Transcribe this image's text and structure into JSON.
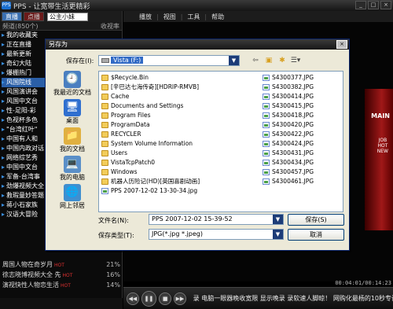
{
  "app": {
    "title": "PPS - 让宽带生活更精彩",
    "logo": "PPS",
    "window_controls": [
      "_",
      "□",
      "×"
    ]
  },
  "left_panel": {
    "tabs": [
      "直播",
      "点播"
    ],
    "search_value": "公主小妹",
    "channel_header": {
      "label": "频道(850个)",
      "right": "收视率"
    },
    "categories": [
      {
        "label": "我的收藏夹",
        "active": false
      },
      {
        "label": "正在直播",
        "active": false
      },
      {
        "label": "最新更新",
        "active": false
      },
      {
        "label": "奇幻大陆",
        "active": false
      },
      {
        "label": "爆棚热门",
        "active": false
      },
      {
        "label": "风国院线",
        "active": true
      },
      {
        "label": "风国演讲会",
        "active": false
      },
      {
        "label": "风国中文台",
        "active": false
      },
      {
        "label": "性-足阳-彩",
        "active": false
      },
      {
        "label": "色视杯多色",
        "active": false
      },
      {
        "label": "\"台湾红叶\"",
        "active": false
      },
      {
        "label": "中国有人和",
        "active": false
      },
      {
        "label": "中国内政对话",
        "active": false
      },
      {
        "label": "网络综艺秀",
        "active": false
      },
      {
        "label": "中国中文台",
        "active": false
      },
      {
        "label": "军备-台湾事",
        "active": false
      },
      {
        "label": "劲爆视频大全",
        "active": false
      },
      {
        "label": "救瑕童妙答题",
        "active": false
      },
      {
        "label": "蒋小石家族",
        "active": false
      },
      {
        "label": "汉语大冒险",
        "active": false
      }
    ],
    "channels": [
      {
        "name": "周国人物在奇岁月",
        "hot": "HOT",
        "rate": "21%"
      },
      {
        "name": "徐志晓博视频大全 先",
        "hot": "HOT",
        "rate": "16%"
      },
      {
        "name": "演视快性人物恋生活",
        "hot": "HOT",
        "rate": "14%"
      }
    ]
  },
  "menubar": {
    "items": [
      "播放",
      "视图",
      "工具",
      "帮助"
    ]
  },
  "video": {
    "promo_text_1": "MAIN",
    "promo_text_2": "JOB\nHOT\nNEW",
    "time": "00:04:01/00:14:23"
  },
  "controls": {
    "buttons": [
      "◀◀",
      "❚❚",
      "■",
      "▶▶"
    ],
    "ticker": "录 电脑一眼器晚收宽限 显示晚录 录软速人脚晾！ 网购化最杨的10秒专诗"
  },
  "dialog": {
    "title": "另存为",
    "close": "×",
    "save_in_label": "保存在(I):",
    "save_in_value": "Vista (F:)",
    "toolbar_icons": [
      "back-arrow-icon",
      "up-folder-icon",
      "new-folder-icon",
      "view-menu-icon"
    ],
    "places": [
      {
        "label": "我最近的文档",
        "icon": "recent-documents-icon",
        "color": "#4a7fc0"
      },
      {
        "label": "桌面",
        "icon": "desktop-icon",
        "color": "#2f6fcf"
      },
      {
        "label": "我的文档",
        "icon": "my-documents-icon",
        "color": "#e0b040"
      },
      {
        "label": "我的电脑",
        "icon": "my-computer-icon",
        "color": "#5a8fc8"
      },
      {
        "label": "网上邻居",
        "icon": "network-places-icon",
        "color": "#3f8fd0"
      }
    ],
    "files_left": [
      {
        "name": "$Recycle.Bin",
        "kind": "folder"
      },
      {
        "name": "[辛巴达七海传奇][HDRIP-RMVB]",
        "kind": "folder"
      },
      {
        "name": "Cache",
        "kind": "folder"
      },
      {
        "name": "Documents and Settings",
        "kind": "folder"
      },
      {
        "name": "Program Files",
        "kind": "folder"
      },
      {
        "name": "ProgramData",
        "kind": "folder"
      },
      {
        "name": "RECYCLER",
        "kind": "folder"
      },
      {
        "name": "System Volume Information",
        "kind": "folder"
      },
      {
        "name": "Users",
        "kind": "folder"
      },
      {
        "name": "VistaTcpPatch0",
        "kind": "folder"
      },
      {
        "name": "Windows",
        "kind": "folder"
      },
      {
        "name": "机器人历险记(HD)[英国喜剧动画]",
        "kind": "folder"
      },
      {
        "name": "PPS 2007-12-02 13-30-34.jpg",
        "kind": "image"
      }
    ],
    "files_right": [
      {
        "name": "S4300377.JPG",
        "kind": "image"
      },
      {
        "name": "S4300382.JPG",
        "kind": "image"
      },
      {
        "name": "S4300414.JPG",
        "kind": "image"
      },
      {
        "name": "S4300415.JPG",
        "kind": "image"
      },
      {
        "name": "S4300418.JPG",
        "kind": "image"
      },
      {
        "name": "S4300420.JPG",
        "kind": "image"
      },
      {
        "name": "S4300422.JPG",
        "kind": "image"
      },
      {
        "name": "S4300424.JPG",
        "kind": "image"
      },
      {
        "name": "S4300431.JPG",
        "kind": "image"
      },
      {
        "name": "S4300434.JPG",
        "kind": "image"
      },
      {
        "name": "S4300457.JPG",
        "kind": "image"
      },
      {
        "name": "S4300461.JPG",
        "kind": "image"
      }
    ],
    "filename_label": "文件名(N):",
    "filename_value": "PPS 2007-12-02 15-39-52",
    "filetype_label": "保存类型(T):",
    "filetype_value": "JPG(*.jpg *.jpeg)",
    "save_button": "保存(S)",
    "cancel_button": "取消"
  }
}
